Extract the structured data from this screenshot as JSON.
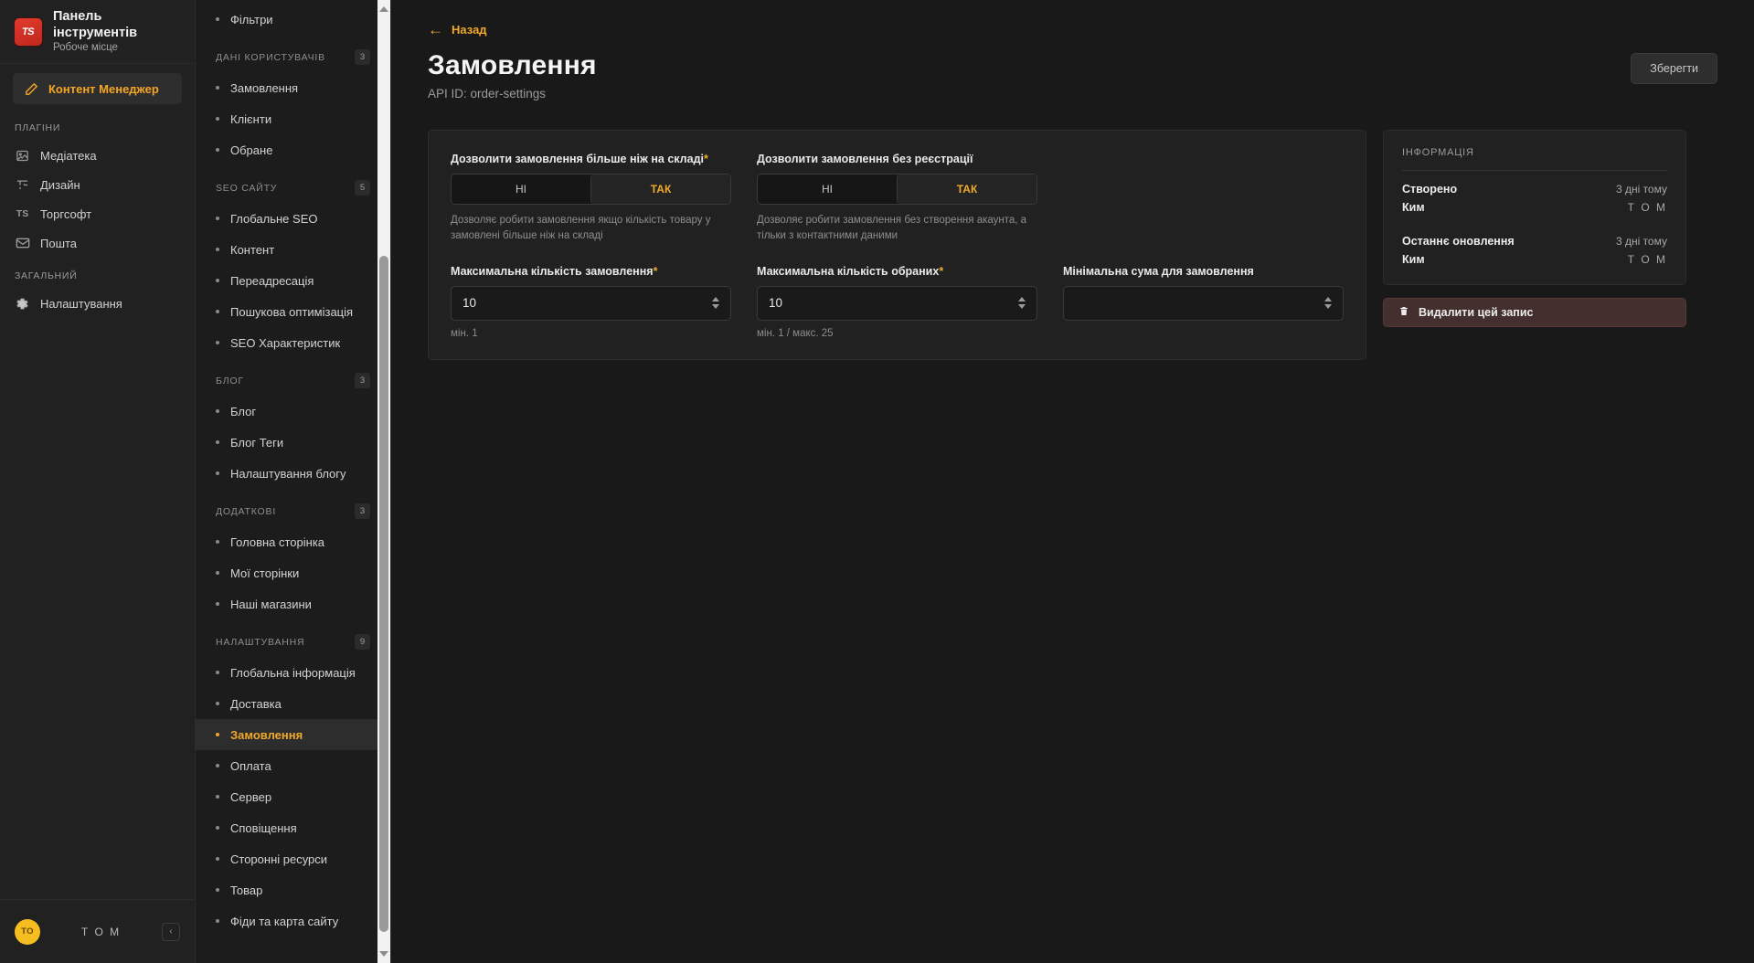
{
  "brand": {
    "logo_text": "TS",
    "title": "Панель інструментів",
    "subtitle": "Робоче місце"
  },
  "sidebar": {
    "main_item": {
      "label": "Контент Менеджер",
      "icon": "pencil-square-icon"
    },
    "groups": [
      {
        "label": "ПЛАГІНИ",
        "items": [
          {
            "label": "Медіатека",
            "icon": "image-icon"
          },
          {
            "label": "Дизайн",
            "icon": "layout-icon"
          },
          {
            "label": "Торгсофт",
            "icon": "ts-icon"
          },
          {
            "label": "Пошта",
            "icon": "mail-icon"
          }
        ]
      },
      {
        "label": "ЗАГАЛЬНИЙ",
        "items": [
          {
            "label": "Налаштування",
            "icon": "gear-icon"
          }
        ]
      }
    ],
    "footer": {
      "avatar_initials": "ТО",
      "user_name": "Т О М",
      "collapse_icon": "chevron-left-icon"
    }
  },
  "subnav": {
    "top_partial_item": "Фільтри",
    "sections": [
      {
        "title": "ДАНІ КОРИСТУВАЧІВ",
        "badge": "3",
        "items": [
          "Замовлення",
          "Клієнти",
          "Обране"
        ]
      },
      {
        "title": "SEO САЙТУ",
        "badge": "5",
        "items": [
          "Глобальне SEO",
          "Контент",
          "Переадресація",
          "Пошукова оптимізація",
          "SEO Характеристик"
        ]
      },
      {
        "title": "БЛОГ",
        "badge": "3",
        "items": [
          "Блог",
          "Блог Теги",
          "Налаштування блогу"
        ]
      },
      {
        "title": "ДОДАТКОВІ",
        "badge": "3",
        "items": [
          "Головна сторінка",
          "Мої сторінки",
          "Наші магазини"
        ]
      },
      {
        "title": "НАЛАШТУВАННЯ",
        "badge": "9",
        "items": [
          "Глобальна інформація",
          "Доставка",
          "Замовлення",
          "Оплата",
          "Сервер",
          "Сповіщення",
          "Сторонні ресурси",
          "Товар",
          "Фіди та карта сайту"
        ]
      }
    ],
    "active_item": "Замовлення"
  },
  "main": {
    "back_label": "Назад",
    "title": "Замовлення",
    "api_id": "API ID: order-settings",
    "save_label": "Зберегти",
    "fields": {
      "allow_overstock": {
        "label": "Дозволити замовлення більше ніж на складі",
        "required": true,
        "options": [
          "НІ",
          "ТАК"
        ],
        "value": "ТАК",
        "hint": "Дозволяє робити замовлення якщо кількість товару у замовлені більше ніж на складі"
      },
      "allow_guest": {
        "label": "Дозволити замовлення без реєстрації",
        "required": false,
        "options": [
          "НІ",
          "ТАК"
        ],
        "value": "ТАК",
        "hint": "Дозволяє робити замовлення без створення акаунта, а тільки з контактними даними"
      },
      "max_order_qty": {
        "label": "Максимальна кількість замовлення",
        "required": true,
        "value": "10",
        "hint": "мін. 1"
      },
      "max_favorites_qty": {
        "label": "Максимальна кількість обраних",
        "required": true,
        "value": "10",
        "hint": "мін. 1 / макс. 25"
      },
      "min_order_sum": {
        "label": "Мінімальна сума для замовлення",
        "required": false,
        "value": "",
        "hint": ""
      }
    }
  },
  "info_panel": {
    "title": "ІНФОРМАЦІЯ",
    "rows": [
      {
        "key": "Створено",
        "value": "3 дні тому",
        "spaced": false
      },
      {
        "key": "Ким",
        "value": "Т О М",
        "spaced": true
      },
      {
        "key": "Останнє оновлення",
        "value": "3 дні тому",
        "spaced": false
      },
      {
        "key": "Ким",
        "value": "Т О М",
        "spaced": true
      }
    ],
    "delete_label": "Видалити цей запис",
    "delete_icon": "trash-icon"
  }
}
